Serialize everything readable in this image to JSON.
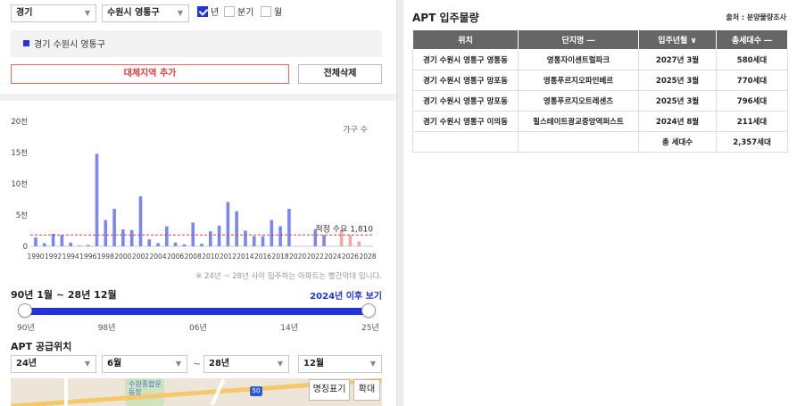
{
  "filters": {
    "province": "경기",
    "city": "수원시 영통구",
    "options": [
      {
        "label": "년",
        "checked": true
      },
      {
        "label": "분기",
        "checked": false
      },
      {
        "label": "월",
        "checked": false
      }
    ]
  },
  "region": {
    "label": "경기 수원시 영통구"
  },
  "buttons": {
    "add_region": "대체지역 추가",
    "delete_all": "전체삭제"
  },
  "chart_data": {
    "type": "bar",
    "legend_label": "가구 수",
    "x": [
      1990,
      1991,
      1992,
      1993,
      1994,
      1995,
      1996,
      1997,
      1998,
      1999,
      2000,
      2001,
      2002,
      2003,
      2004,
      2005,
      2006,
      2007,
      2008,
      2009,
      2010,
      2011,
      2012,
      2013,
      2014,
      2015,
      2016,
      2017,
      2018,
      2019,
      2020,
      2021,
      2022,
      2023,
      2024,
      2025,
      2026,
      2027,
      2028
    ],
    "x_tick_labels": [
      "1990",
      "1992",
      "1994",
      "1996",
      "1998",
      "2000",
      "2002",
      "2004",
      "2006",
      "2008",
      "2010",
      "2012",
      "2014",
      "2016",
      "2018",
      "2020",
      "2022",
      "2024",
      "2026",
      "2028"
    ],
    "values": [
      1400,
      500,
      2000,
      1800,
      600,
      100,
      200,
      14800,
      4200,
      6000,
      2700,
      2600,
      8000,
      1100,
      500,
      3200,
      600,
      300,
      3800,
      400,
      2400,
      3300,
      7100,
      5600,
      2500,
      1600,
      1600,
      4200,
      3200,
      6000,
      0,
      0,
      2700,
      1800,
      0,
      2600,
      1800,
      800,
      0
    ],
    "highlight_from": 2024,
    "y_ticks": [
      0,
      5000,
      10000,
      15000,
      20000
    ],
    "y_tick_labels": [
      "0",
      "5천",
      "10천",
      "15천",
      "20천"
    ],
    "ylim": [
      0,
      20000
    ],
    "threshold": {
      "label": "적정 수요 1,810",
      "value": 1810
    },
    "bar_color": "#7b87ef",
    "highlight_color": "#f2a9a9",
    "threshold_color": "#e04444",
    "note": "※ 24년 ~ 28년 사이 입주하는 아파트는 빨간막대 입니다."
  },
  "range": {
    "title": "90년 1월 ~ 28년 12월",
    "link": "2024년 이후 보기",
    "ticks": [
      {
        "label": "90년",
        "pos": 0
      },
      {
        "label": "98년",
        "pos": 0.235
      },
      {
        "label": "06년",
        "pos": 0.5
      },
      {
        "label": "14년",
        "pos": 0.765
      },
      {
        "label": "25년",
        "pos": 1
      }
    ]
  },
  "supply": {
    "title": "APT 공급위치",
    "start_year": "24년",
    "start_month": "6월",
    "tilde": "~",
    "end_year": "28년",
    "end_month": "12월"
  },
  "map": {
    "place_label": "수원종합운동장",
    "highway_number": "50",
    "name_button": "명칭표기",
    "zoom_button": "확대"
  },
  "apt": {
    "title": "APT 입주물량",
    "source": "출처 : 분양물량조사",
    "columns": [
      "위치",
      "단지명 ―",
      "입주년월 ∨",
      "총세대수 ―"
    ],
    "rows": [
      [
        "경기 수원시 영통구 영통동",
        "영통자이센트럴파크",
        "2027년 3월",
        "580세대"
      ],
      [
        "경기 수원시 영통구 망포동",
        "영통푸르지오파인베르",
        "2025년 3월",
        "770세대"
      ],
      [
        "경기 수원시 영통구 망포동",
        "영통푸르지오트레센츠",
        "2025년 3월",
        "796세대"
      ],
      [
        "경기 수원시 영통구 이의동",
        "힐스테이트광교중앙역퍼스트",
        "2024년 8월",
        "211세대"
      ]
    ],
    "total_label": "총 세대수",
    "total_value": "2,357세대"
  }
}
